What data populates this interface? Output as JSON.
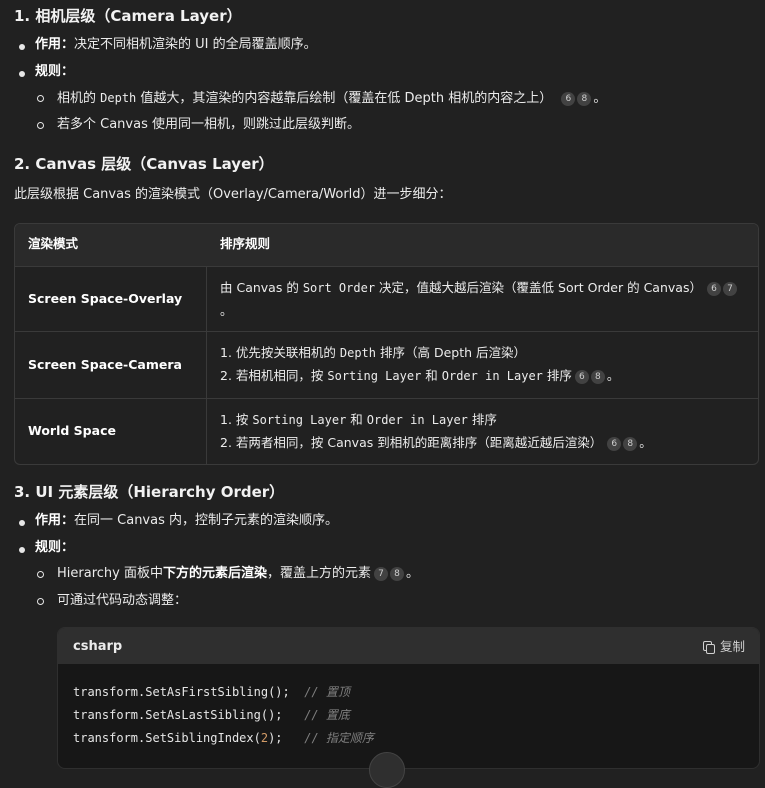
{
  "sec1": {
    "title": "1. 相机层级（Camera Layer）",
    "purpose_label": "作用：",
    "purpose_text": "决定不同相机渲染的 UI 的全局覆盖顺序。",
    "rules_label": "规则：",
    "rule1_a": "相机的 ",
    "rule1_code": "Depth",
    "rule1_b": " 值越大，其渲染的内容越靠后绘制（覆盖在低 Depth 相机的内容之上）",
    "rule1_cites": [
      "6",
      "8"
    ],
    "rule1_end": "。",
    "rule2": "若多个 Canvas 使用同一相机，则跳过此层级判断。"
  },
  "sec2": {
    "title": "2. Canvas 层级（Canvas Layer）",
    "intro": "此层级根据 Canvas 的渲染模式（Overlay/Camera/World）进一步细分：",
    "table": {
      "headers": [
        "渲染模式",
        "排序规则"
      ],
      "r1_mode": "Screen Space-Overlay",
      "r1_a": "由 Canvas 的 ",
      "r1_code": "Sort Order",
      "r1_b": " 决定，值越大越后渲染（覆盖低 Sort Order 的 Canvas）",
      "r1_cites": [
        "6",
        "7"
      ],
      "r1_end": "。",
      "r2_mode": "Screen Space-Camera",
      "r2_l1_a": "1. 优先按关联相机的 ",
      "r2_l1_code": "Depth",
      "r2_l1_b": " 排序（高 Depth 后渲染）",
      "r2_l2_a": "2. 若相机相同，按 ",
      "r2_l2_code1": "Sorting Layer",
      "r2_l2_mid": " 和 ",
      "r2_l2_code2": "Order in Layer",
      "r2_l2_b": " 排序",
      "r2_cites": [
        "6",
        "8"
      ],
      "r2_end": "。",
      "r3_mode": "World Space",
      "r3_l1_a": "1. 按 ",
      "r3_l1_code1": "Sorting Layer",
      "r3_l1_mid": " 和 ",
      "r3_l1_code2": "Order in Layer",
      "r3_l1_b": " 排序",
      "r3_l2": "2. 若两者相同，按 Canvas 到相机的距离排序（距离越近越后渲染）",
      "r3_cites": [
        "6",
        "8"
      ],
      "r3_end": "。"
    }
  },
  "sec3": {
    "title": "3. UI 元素层级（Hierarchy Order）",
    "purpose_label": "作用：",
    "purpose_text": "在同一 Canvas 内，控制子元素的渲染顺序。",
    "rules_label": "规则：",
    "rule1_a": "Hierarchy 面板中",
    "rule1_bold": "下方的元素后渲染",
    "rule1_b": "，覆盖上方的元素",
    "rule1_cites": [
      "7",
      "8"
    ],
    "rule1_end": "。",
    "rule2": "可通过代码动态调整："
  },
  "code": {
    "lang": "csharp",
    "copy_label": "复制",
    "l1_code": "transform.SetAsFirstSibling();",
    "l1_comment": "// 置顶",
    "l2_code": "transform.SetAsLastSibling();",
    "l2_comment": "// 置底",
    "l3_a": "transform.SetSiblingIndex(",
    "l3_num": "2",
    "l3_b": ");",
    "l3_comment": "// 指定顺序"
  }
}
